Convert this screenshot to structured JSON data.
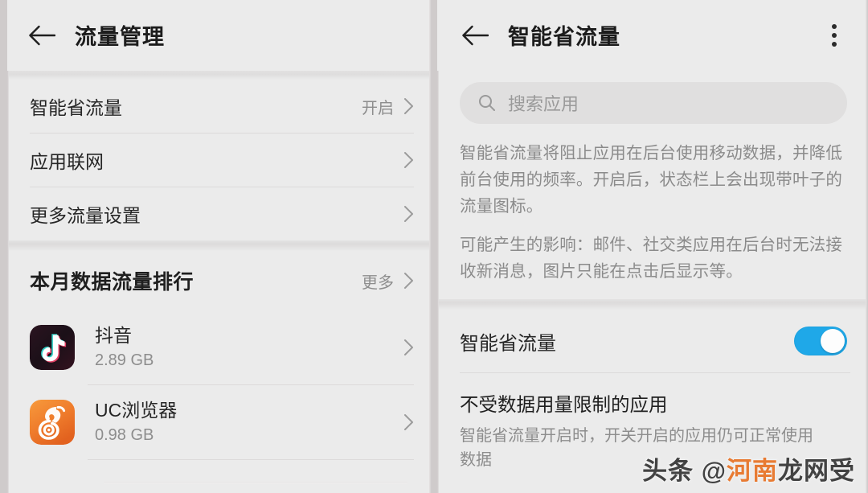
{
  "colors": {
    "panel_bg": "#ebebeb",
    "outer_bg": "#cfcbcb",
    "text_primary": "#262626",
    "text_secondary": "#8d8d8d",
    "divider": "#dcdada",
    "switch_on": "#1fa8e8",
    "watermark_accent": "#e8762a",
    "tiktok_icon": "#1c1018",
    "uc_icon": "#ee7b2e"
  },
  "left_panel": {
    "header": {
      "back_icon": "arrow-left-icon",
      "title": "流量管理"
    },
    "settings_rows": [
      {
        "label": "智能省流量",
        "value": "开启",
        "chevron": true
      },
      {
        "label": "应用联网",
        "value": "",
        "chevron": true
      },
      {
        "label": "更多流量设置",
        "value": "",
        "chevron": true
      }
    ],
    "ranking_section": {
      "title": "本月数据流量排行",
      "more_label": "更多",
      "apps": [
        {
          "name": "抖音",
          "size": "2.89 GB",
          "icon": "tiktok-app-icon"
        },
        {
          "name": "UC浏览器",
          "size": "0.98 GB",
          "icon": "uc-browser-app-icon"
        }
      ]
    }
  },
  "right_panel": {
    "header": {
      "back_icon": "arrow-left-icon",
      "title": "智能省流量",
      "menu_icon": "kebab-menu-icon"
    },
    "search": {
      "icon": "search-icon",
      "placeholder": "搜索应用",
      "value": ""
    },
    "description": [
      "智能省流量将阻止应用在后台使用移动数据，并降低前台使用的频率。开启后，状态栏上会出现带叶子的流量图标。",
      "可能产生的影响：邮件、社交类应用在后台时无法接收新消息，图片只能在点击后显示等。"
    ],
    "toggle_row": {
      "label": "智能省流量",
      "state": "on"
    },
    "unrestricted_block": {
      "title": "不受数据用量限制的应用",
      "subtitle": "智能省流量开启时，开关开启的应用仍可正常使用数据"
    }
  },
  "watermark": {
    "prefix": "头条 @",
    "accent": "河南",
    "suffix": "龙网受"
  }
}
